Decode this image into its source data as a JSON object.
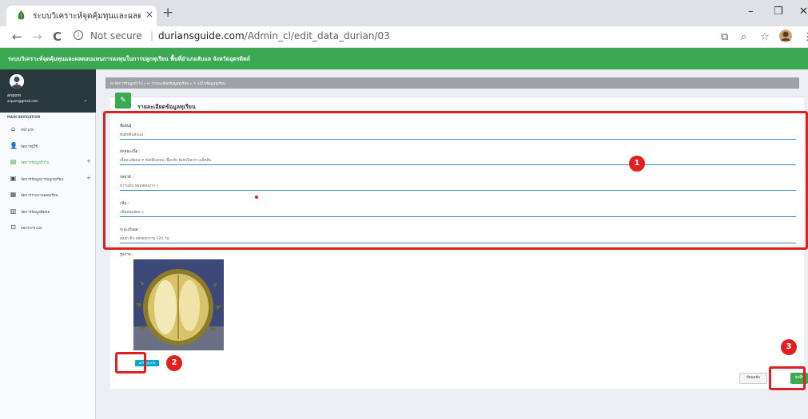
{
  "browser": {
    "tab_title": "ระบบวิเคราะห์จุดคุ้มทุนและผลตอบแทน",
    "tab_close": "×",
    "new_tab": "+",
    "min": "–",
    "max": "❐",
    "close": "✕",
    "back": "←",
    "forward": "→",
    "reload": "C",
    "info_glyph": "i",
    "security": "Not secure",
    "separator": "|",
    "url_host": "duriansguide.com",
    "url_path": "/Admin_cl/edit_data_durian/03",
    "translate": "⧉",
    "zoom": "⌕",
    "star": "☆",
    "menu": "⋮"
  },
  "app": {
    "title": "ระบบวิเคราะห์จุดคุ้มทุนและผลตอบแทนการลงทุนในการปลูกทุเรียน พื้นที่อำเภอลับแล จังหวัดอุตรดิตถ์",
    "accent": "#3ba951"
  },
  "user": {
    "name": "anpom",
    "email": "anpom@gmail.com",
    "caret": "⌄"
  },
  "sidebar": {
    "header": "MAIN NAVIGATION",
    "items": [
      {
        "label": "หน้าแรก",
        "icon": "home-icon",
        "glyph": "⌂"
      },
      {
        "label": "จัดการผู้ใช้",
        "icon": "user-icon",
        "glyph": "👤"
      },
      {
        "label": "จัดการข้อมูลทั่วไป",
        "icon": "table-icon",
        "glyph": "▤",
        "plus": "+"
      },
      {
        "label": "จัดการข้อมูลการปลูกทุเรียน",
        "icon": "calendar-icon",
        "glyph": "▣",
        "plus": "+"
      },
      {
        "label": "จัดการรายงานผลทุเรียน",
        "icon": "list-icon",
        "glyph": "▦"
      },
      {
        "label": "จัดการข้อมูลติดต่อ",
        "icon": "chat-icon",
        "glyph": "▥"
      },
      {
        "label": "ออกจากระบบ",
        "icon": "logout-icon",
        "glyph": "⊡"
      }
    ]
  },
  "breadcrumb": "⊟ จัดการข้อมูลทั่วไป  »  ✏ รายละเอียดข้อมูลทุเรียน  »  ✎ แก้ไขข้อมูลทุเรียน",
  "form": {
    "box_icon": "✎",
    "title": "รายละเอียดข้อมูลทุเรียน",
    "fields": [
      {
        "label": "ชื่อพันธุ์ :",
        "value": "พันธุ์หลินลับแล"
      },
      {
        "label": "ลักษณะเนื้อ :",
        "value": "เนื้อละเอียดมาก สีเหลืองอ่อน เนื้อแห้ง มีเส้นใยมาก เมล็ดลีบ"
      },
      {
        "label": "รสชาติ :",
        "value": "หวานมัน หอมหอมมาก ๆ"
      },
      {
        "label": "กลิ่น :",
        "value": "กลิ่นหอมอ่อน ๆ"
      },
      {
        "label": "ระยะเก็บผล :",
        "value": "ผลสุก ดิบ หลังดอกบาน 120 วัน"
      }
    ],
    "image_label": "รูปภาพ :",
    "edit_image_label": "แก้ไขรูปภาพ",
    "back_label": "ย้อนกลับ",
    "save_label": "บันทึก"
  },
  "callouts": [
    "1",
    "2",
    "3"
  ]
}
